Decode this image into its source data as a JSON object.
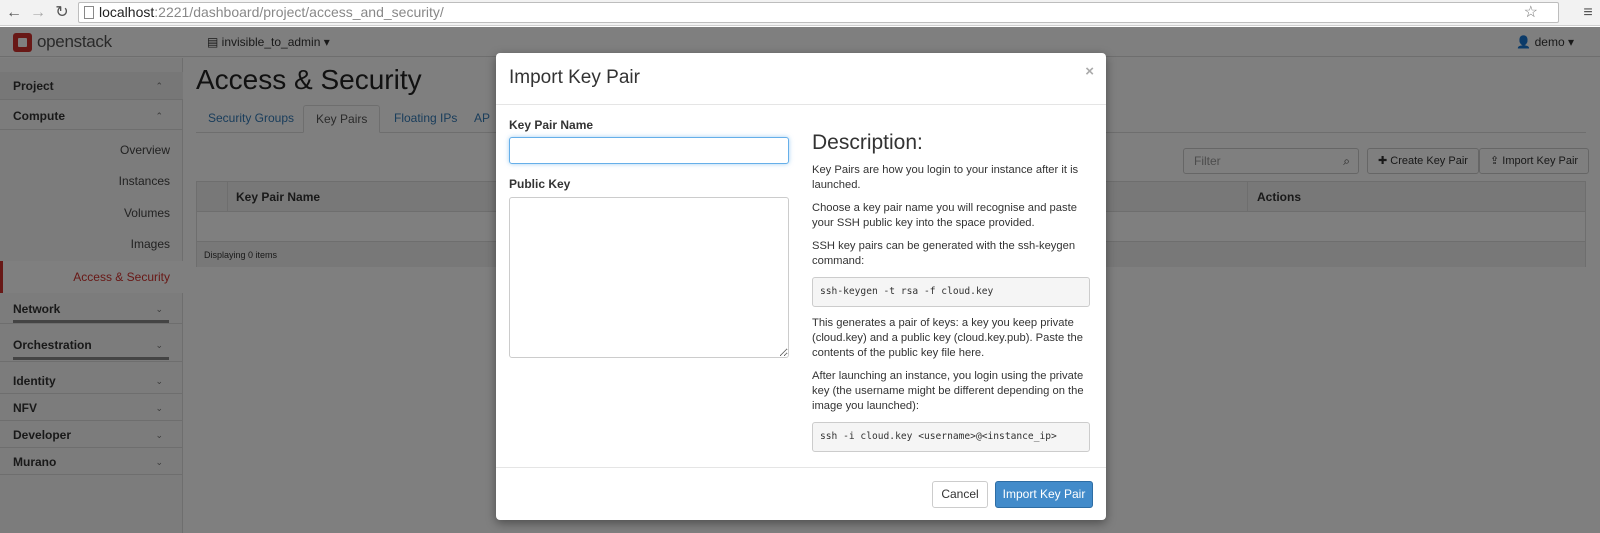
{
  "browser": {
    "url_host": "localhost",
    "url_path": ":2221/dashboard/project/access_and_security/"
  },
  "topnav": {
    "logo_text": "openstack",
    "project": "invisible_to_admin ▾",
    "user": "demo ▾"
  },
  "sidebar": {
    "sections": [
      {
        "label": "Project",
        "chevron": "⌃"
      },
      {
        "label": "Compute",
        "chevron": "⌃"
      },
      {
        "label": "Network",
        "chevron": "⌄"
      },
      {
        "label": "Orchestration",
        "chevron": "⌄"
      },
      {
        "label": "Identity",
        "chevron": "⌄"
      },
      {
        "label": "NFV",
        "chevron": "⌄"
      },
      {
        "label": "Developer",
        "chevron": "⌄"
      },
      {
        "label": "Murano",
        "chevron": "⌄"
      }
    ],
    "items": [
      {
        "label": "Overview"
      },
      {
        "label": "Instances"
      },
      {
        "label": "Volumes"
      },
      {
        "label": "Images"
      },
      {
        "label": "Access & Security"
      }
    ]
  },
  "page": {
    "title": "Access & Security",
    "tabs": [
      "Security Groups",
      "Key Pairs",
      "Floating IPs",
      "AP"
    ],
    "filter_placeholder": "Filter",
    "create_button": "Create Key Pair",
    "import_button": "Import Key Pair",
    "table": {
      "headers": [
        "Key Pair Name",
        "Actions"
      ],
      "footer": "Displaying 0 items"
    }
  },
  "modal": {
    "title": "Import Key Pair",
    "close": "×",
    "name_label": "Key Pair Name",
    "name_value": "",
    "key_label": "Public Key",
    "key_value": "",
    "desc_title": "Description:",
    "desc_p1": "Key Pairs are how you login to your instance after it is launched.",
    "desc_p2": "Choose a key pair name you will recognise and paste your SSH public key into the space provided.",
    "desc_p3": "SSH key pairs can be generated with the ssh-keygen command:",
    "code1": "ssh-keygen -t rsa -f cloud.key",
    "desc_p4": "This generates a pair of keys: a key you keep private (cloud.key) and a public key (cloud.key.pub). Paste the contents of the public key file here.",
    "desc_p5": "After launching an instance, you login using the private key (the username might be different depending on the image you launched):",
    "code2": "ssh -i cloud.key <username>@<instance_ip>",
    "cancel": "Cancel",
    "submit": "Import Key Pair"
  },
  "colors": {
    "primary": "#428bca",
    "brand_red": "#d0312d",
    "link": "#337ab7"
  }
}
